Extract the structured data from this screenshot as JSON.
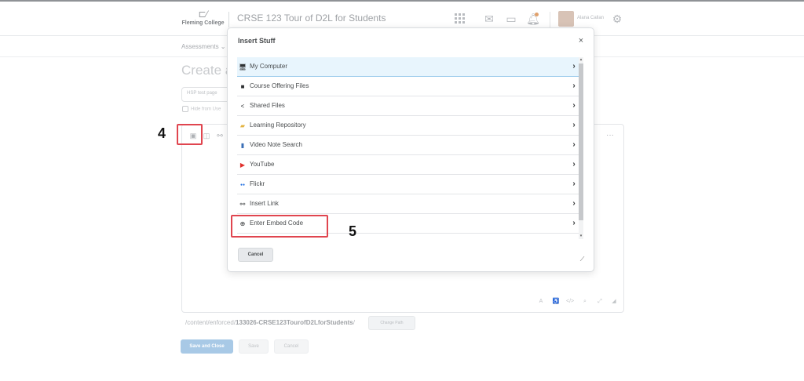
{
  "header": {
    "logo_text": "Fleming College",
    "course_title": "CRSE 123 Tour of D2L for Students",
    "user_name": "Alana Callan",
    "icons": [
      "waffle-grid-icon",
      "mail-icon",
      "chat-icon",
      "bell-icon",
      "gear-icon"
    ]
  },
  "subnav": {
    "assessments_label": "Assessments ⌄"
  },
  "page": {
    "title": "Create a",
    "name_value": "HSP test page",
    "hide_label": "Hide from Use"
  },
  "editor": {
    "toolbar_icons": [
      "insert-stuff-icon",
      "insert-image-icon",
      "insert-link-icon"
    ],
    "more_label": "···",
    "bottom_icons": [
      "spellcheck-icon",
      "accessibility-icon",
      "source-code-icon",
      "preview-icon",
      "fullscreen-icon",
      "resize-icon"
    ],
    "bottom_icon_glyphs": [
      "A",
      "♿",
      "</>",
      "⌕",
      "⤢",
      "◢"
    ]
  },
  "path": {
    "prefix": "/content/enforced/",
    "folder": "133026-CRSE123TourofD2LforStudents",
    "suffix": "/",
    "change_label": "Change Path"
  },
  "footer_buttons": {
    "save_close": "Save and Close",
    "save": "Save",
    "cancel": "Cancel"
  },
  "annotations": {
    "step4": "4",
    "step5": "5"
  },
  "dialog": {
    "title": "Insert Stuff",
    "close_glyph": "×",
    "items": [
      {
        "label": "My Computer",
        "icon": "computer-icon",
        "glyph": "🖥",
        "color": "#2f3234"
      },
      {
        "label": "Course Offering Files",
        "icon": "folder-icon",
        "glyph": "■",
        "color": "#2f3234"
      },
      {
        "label": "Shared Files",
        "icon": "share-icon",
        "glyph": "<",
        "color": "#2f3234"
      },
      {
        "label": "Learning Repository",
        "icon": "learning-repository-icon",
        "glyph": "▰",
        "color": "#e3b341"
      },
      {
        "label": "Video Note Search",
        "icon": "video-note-icon",
        "glyph": "▮",
        "color": "#3b6fb6"
      },
      {
        "label": "YouTube",
        "icon": "youtube-icon",
        "glyph": "▶",
        "color": "#e0302c"
      },
      {
        "label": "Flickr",
        "icon": "flickr-icon",
        "glyph": "●●",
        "color": "#1f6ee0"
      },
      {
        "label": "Insert Link",
        "icon": "link-icon",
        "glyph": "⚯",
        "color": "#2f3234"
      },
      {
        "label": "Enter Embed Code",
        "icon": "globe-icon",
        "glyph": "⊕",
        "color": "#2f3234"
      }
    ],
    "chevron_glyph": "›",
    "cancel_label": "Cancel"
  },
  "colors": {
    "active_row_bg": "#e8f5fd",
    "highlight_red": "#e0454f",
    "primary_button": "#a8c9e6"
  }
}
